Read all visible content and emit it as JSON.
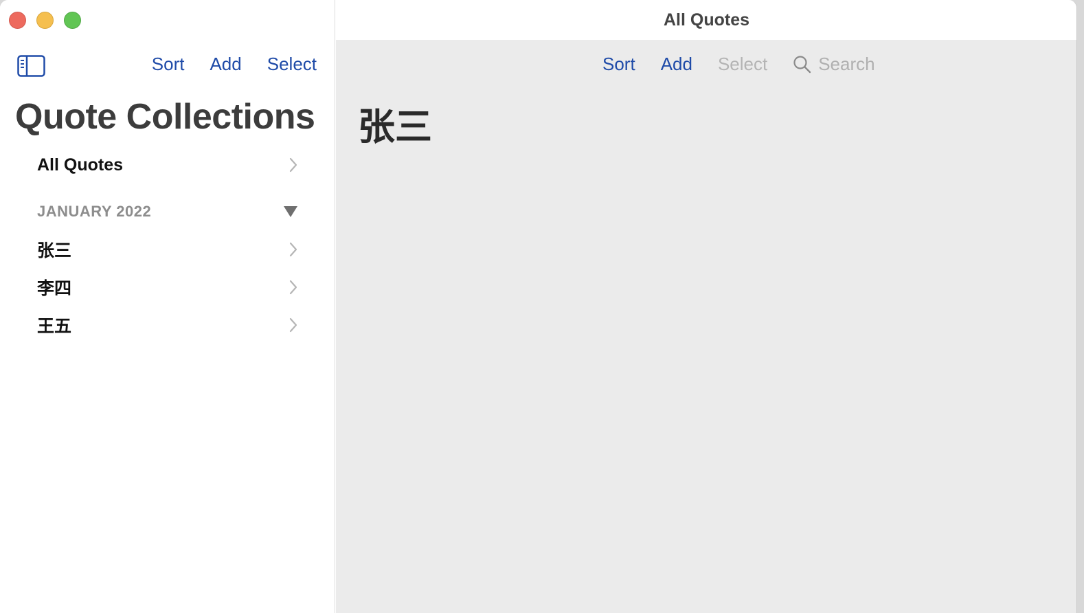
{
  "window": {
    "title": "All Quotes"
  },
  "sidebar": {
    "toolbar": {
      "sort_label": "Sort",
      "add_label": "Add",
      "select_label": "Select"
    },
    "title": "Quote Collections",
    "all_quotes_label": "All Quotes",
    "section": {
      "label": "JANUARY 2022",
      "items": [
        {
          "label": "张三"
        },
        {
          "label": "李四"
        },
        {
          "label": "王五"
        }
      ]
    }
  },
  "main": {
    "toolbar": {
      "sort_label": "Sort",
      "add_label": "Add",
      "select_label": "Select",
      "search_placeholder": "Search"
    },
    "content_title": "张三"
  },
  "colors": {
    "accent": "#1f4ba8",
    "disabled": "#b4b4b4",
    "main_bg": "#ebebeb"
  }
}
